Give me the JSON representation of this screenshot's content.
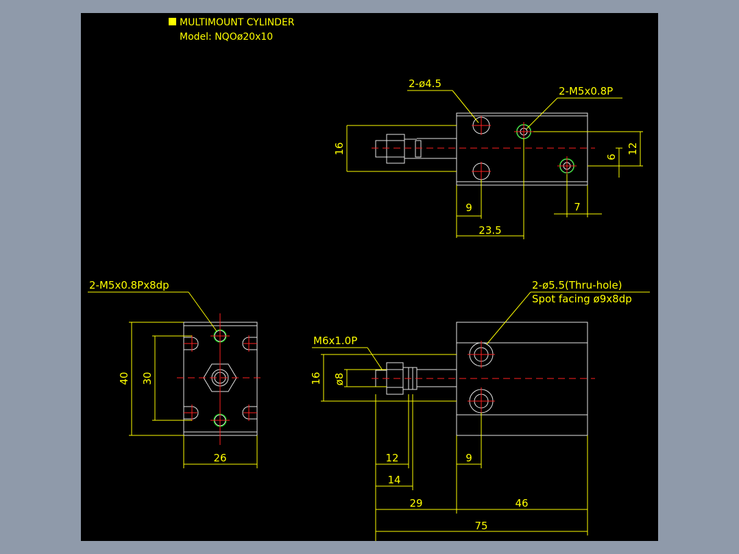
{
  "title": {
    "line1": "MULTIMOUNT CYLINDER",
    "line2": "Model: NQOø20x10"
  },
  "callouts": {
    "top_holes": "2-ø4.5",
    "top_ports": "2-M5x0.8P",
    "end_taps": "2-M5x0.8Px8dp",
    "thru_hole_1": "2-ø5.5(Thru-hole)",
    "thru_hole_2": "Spot facing ø9x8dp",
    "rod_thread": "M6x1.0P"
  },
  "dimensions": {
    "top_16": "16",
    "top_12": "12",
    "top_6": "6",
    "top_9": "9",
    "top_7": "7",
    "top_23_5": "23.5",
    "end_40": "40",
    "end_30": "30",
    "end_26": "26",
    "side_16": "16",
    "side_d8": "ø8",
    "side_12": "12",
    "side_14": "14",
    "side_9": "9",
    "side_29": "29",
    "side_46": "46",
    "side_75": "75"
  },
  "colors": {
    "background": "#000000",
    "frame": "#8f9aaa",
    "dimension": "#ffff00",
    "outline": "#e8e8e8",
    "centerline": "#ff2020",
    "thread": "#00e000"
  }
}
